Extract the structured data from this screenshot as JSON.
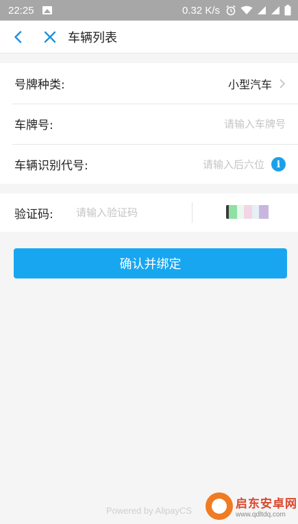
{
  "status_bar": {
    "time": "22:25",
    "network_speed": "0.32 K/s",
    "icons": [
      "image-icon",
      "alarm-icon",
      "wifi-icon",
      "signal-icon",
      "signal-icon",
      "battery-icon"
    ]
  },
  "title_bar": {
    "title": "车辆列表",
    "icons": [
      "back-chevron-icon",
      "close-icon"
    ]
  },
  "form": {
    "plate_type": {
      "label": "号牌种类:",
      "value": "小型汽车"
    },
    "plate_number": {
      "label": "车牌号:",
      "placeholder": "请输入车牌号"
    },
    "vin": {
      "label": "车辆识别代号:",
      "placeholder": "请输入后六位",
      "info_icon": "i"
    },
    "captcha": {
      "label": "验证码:",
      "placeholder": "请输入验证码"
    }
  },
  "submit_label": "确认并绑定",
  "footer": "Powered by AlipayCS",
  "watermark": {
    "cn": "启东安卓网",
    "url": "www.qdltdq.com"
  },
  "colors": {
    "accent": "#18a6f0",
    "info": "#1aa0e9",
    "status_bar": "#a7a7a7",
    "background": "#f5f5f5"
  }
}
